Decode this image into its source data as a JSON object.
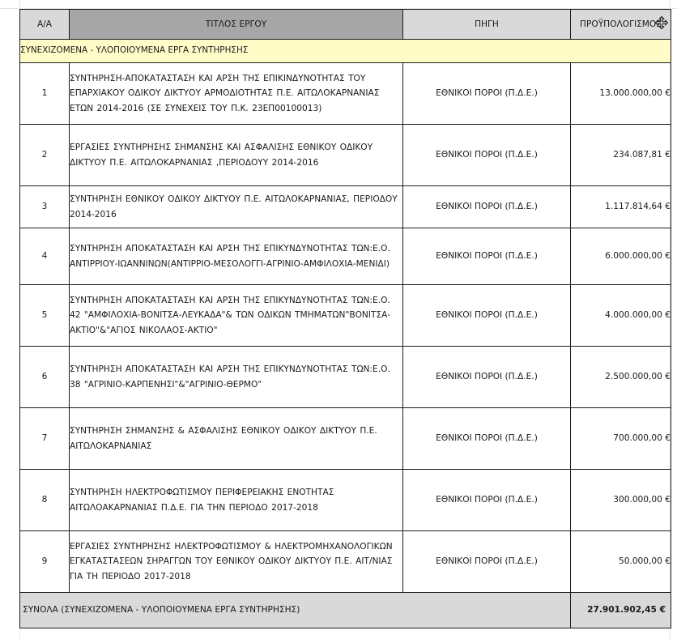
{
  "header": {
    "col_aa": "Α/Α",
    "col_title": "ΤΙΤΛΟΣ ΕΡΓΟΥ",
    "col_source": "ΠΗΓΗ",
    "col_budget": "ΠΡΟΫΠΟΛΟΓΙΣΜΟΣ"
  },
  "section": {
    "label": "ΣΥΝΕΧΙΖΟΜΕΝΑ - ΥΛΟΠΟΙΟΥΜΕΝΑ ΕΡΓΑ ΣΥΝΤΗΡΗΣΗΣ"
  },
  "rows": [
    {
      "num": "1",
      "title": "ΣΥΝΤΗΡΗΣΗ-ΑΠΟΚΑΤΑΣΤΑΣΗ ΚΑΙ ΑΡΣΗ ΤΗΣ ΕΠΙΚΙΝΔΥΝΟΤΗΤΑΣ ΤΟΥ ΕΠΑΡΧΙΑΚΟΥ ΟΔΙΚΟΥ ΔΙΚΤΥΟΥ ΑΡΜΟΔΙΟΤΗΤΑΣ Π.Ε. ΑΙΤΩΛΟΚΑΡΝΑΝΙΑΣ ΕΤΩΝ 2014-2016 (ΣΕ ΣΥΝΕΧΕΙΣ ΤΟΥ Π.Κ. 23ΕΠ00100013)",
      "source": "ΕΘΝΙΚΟΙ ΠΟΡΟΙ (Π.Δ.Ε.)",
      "budget": "13.000.000,00 €"
    },
    {
      "num": "2",
      "title": "ΕΡΓΑΣΙΕΣ ΣΥΝΤΗΡΗΣΗΣ ΣΗΜΑΝΣΗΣ ΚΑΙ ΑΣΦΑΛΙΣΗΣ ΕΘΝΙΚΟΥ ΟΔΙΚΟΥ ΔΙΚΤΥΟΥ Π.Ε. ΑΙΤΩΛΟΚΑΡΝΑΝΙΑΣ ,ΠΕΡΙΟΔΟΥΥ 2014-2016",
      "source": "ΕΘΝΙΚΟΙ ΠΟΡΟΙ (Π.Δ.Ε.)",
      "budget": "234.087,81 €"
    },
    {
      "num": "3",
      "title": "ΣΥΝΤΗΡΗΣΗ ΕΘΝΙΚΟΥ ΟΔΙΚΟΥ ΔΙΚΤΥΟΥ Π.Ε. ΑΙΤΩΛΟΚΑΡΝΑΝΙΑΣ, ΠΕΡΙΟΔΟΥ 2014-2016",
      "source": "ΕΘΝΙΚΟΙ ΠΟΡΟΙ (Π.Δ.Ε.)",
      "budget": "1.117.814,64 €"
    },
    {
      "num": "4",
      "title": "ΣΥΝΤΗΡΗΣΗ ΑΠΟΚΑΤΑΣΤΑΣΗ ΚΑΙ ΑΡΣΗ ΤΗΣ ΕΠΙΚΥΝΔΥΝΟΤΗΤΑΣ ΤΩΝ:Ε.Ο. ΑΝΤΙΡΡΙΟΥ-ΙΩΑΝΝΙΝΩΝ(ΑΝΤΙΡΡΙΟ-ΜΕΣΟΛΟΓΓΙ-ΑΓΡΙΝΙΟ-ΑΜΦΙΛΟΧΙΑ-ΜΕΝΙΔΙ)",
      "source": "ΕΘΝΙΚΟΙ ΠΟΡΟΙ (Π.Δ.Ε.)",
      "budget": "6.000.000,00 €"
    },
    {
      "num": "5",
      "title": "ΣΥΝΤΗΡΗΣΗ ΑΠΟΚΑΤΑΣΤΑΣΗ ΚΑΙ ΑΡΣΗ ΤΗΣ ΕΠΙΚΥΝΔΥΝΟΤΗΤΑΣ ΤΩΝ:Ε.Ο. 42 \"ΑΜΦΙΛΟΧΙΑ-ΒΟΝΙΤΣΑ-ΛΕΥΚΑΔΑ\"& ΤΩΝ ΟΔΙΚΩΝ ΤΜΗΜΑΤΩΝ\"ΒΟΝΙΤΣΑ-ΑΚΤΙΟ\"&\"ΑΓΙΟΣ ΝΙΚΟΛΑΟΣ-ΑΚΤΙΟ\"",
      "source": "ΕΘΝΙΚΟΙ ΠΟΡΟΙ (Π.Δ.Ε.)",
      "budget": "4.000.000,00 €"
    },
    {
      "num": "6",
      "title": "ΣΥΝΤΗΡΗΣΗ ΑΠΟΚΑΤΑΣΤΑΣΗ ΚΑΙ ΑΡΣΗ ΤΗΣ ΕΠΙΚΥΝΔΥΝΟΤΗΤΑΣ ΤΩΝ:Ε.Ο. 38 \"ΑΓΡΙΝΙΟ-ΚΑΡΠΕΝΗΣΙ\"&\"ΑΓΡΙΝΙΟ-ΘΕΡΜΟ\"",
      "source": "ΕΘΝΙΚΟΙ ΠΟΡΟΙ (Π.Δ.Ε.)",
      "budget": "2.500.000,00 €"
    },
    {
      "num": "7",
      "title": "ΣΥΝΤΗΡΗΣΗ ΣΗΜΑΝΣΗΣ & ΑΣΦΑΛΙΣΗΣ ΕΘΝΙΚΟΥ ΟΔΙΚΟΥ ΔΙΚΤΥΟΥ Π.Ε. ΑΙΤΩΛΟΚΑΡΝΑΝΙΑΣ",
      "source": "ΕΘΝΙΚΟΙ ΠΟΡΟΙ (Π.Δ.Ε.)",
      "budget": "700.000,00 €"
    },
    {
      "num": "8",
      "title": "ΣΥΝΤΗΡΗΣΗ ΗΛΕΚΤΡΟΦΩΤΙΣΜΟΥ ΠΕΡΙΦΕΡΕΙΑΚΗΣ ΕΝΟΤΗΤΑΣ ΑΙΤΩΛΟΑΚΑΡΝΑΝΙΑΣ Π.Δ.Ε. ΓΙΑ ΤΗΝ ΠΕΡΙΟΔΟ 2017-2018",
      "source": "ΕΘΝΙΚΟΙ ΠΟΡΟΙ (Π.Δ.Ε.)",
      "budget": "300.000,00 €"
    },
    {
      "num": "9",
      "title": "ΕΡΓΑΣΙΕΣ ΣΥΝΤΗΡΗΣΗΣ ΗΛΕΚΤΡΟΦΩΤΙΣΜΟΥ & ΗΛΕΚΤΡΟΜΗΧΑΝΟΛΟΓΙΚΩΝ ΕΓΚΑΤΑΣΤΑΣΕΩΝ ΣΗΡΑΓΓΩΝ ΤΟΥ ΕΘΝΙΚΟΥ ΟΔΙΚΟΥ ΔΙΚΤΥΟΥ Π.Ε. ΑΙΤ/ΝΙΑΣ ΓΙΑ ΤΗ ΠΕΡΙΟΔΟ 2017-2018",
      "source": "ΕΘΝΙΚΟΙ ΠΟΡΟΙ (Π.Δ.Ε.)",
      "budget": "50.000,00 €"
    }
  ],
  "total": {
    "label": "ΣΥΝΟΛΑ (ΣΥΝΕΧΙΖΟΜΕΝΑ - ΥΛΟΠΟΙΟΥΜΕΝΑ ΕΡΓΑ ΣΥΝΤΗΡΗΣΗΣ)",
    "amount": "27.901.902,45 €"
  },
  "colors": {
    "header_bg": "#d9d9d9",
    "title_header_bg": "#a6a6a6",
    "section_bg": "#fffcc8",
    "total_bg": "#d9d9d9"
  },
  "icons": {
    "cursor": "move-cursor-icon"
  }
}
